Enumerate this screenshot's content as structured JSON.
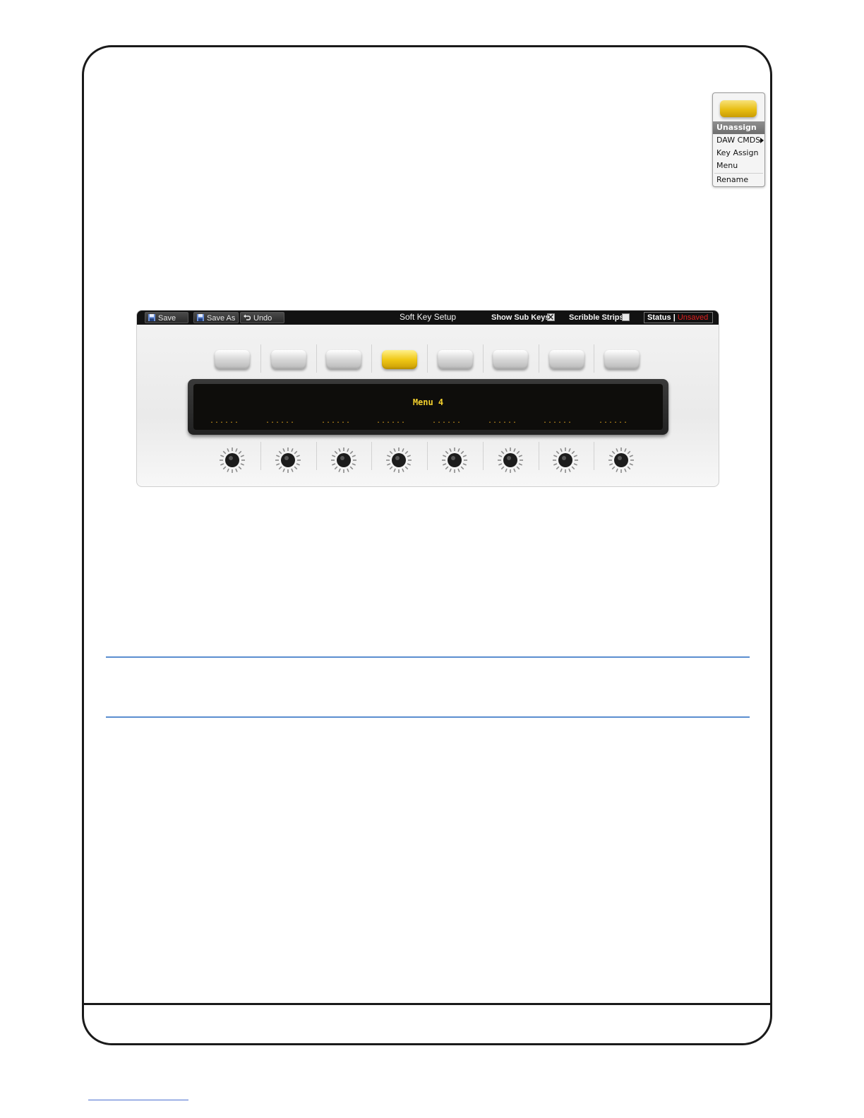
{
  "context_menu": {
    "items": [
      "Unassign",
      "DAW CMDS",
      "Key Assign",
      "Menu",
      "Rename"
    ],
    "selected_item": "Unassign",
    "key_color": "#e8be13"
  },
  "toolbar": {
    "save_label": "Save",
    "save_as_label": "Save As",
    "undo_label": "Undo",
    "title": "Soft Key Setup",
    "show_sub_keys_label": "Show Sub Keys",
    "show_sub_keys_checked": true,
    "scribble_strips_label": "Scribble Strips",
    "scribble_strips_checked": false,
    "status_label": "Status",
    "status_separator": "|",
    "status_value": "Unsaved",
    "status_value_color": "#e02020"
  },
  "soft_keys": {
    "count": 8,
    "active_index": 3,
    "active_color": "#f0c816"
  },
  "display": {
    "title": "Menu 4",
    "slot_values": [
      "......",
      "......",
      "......",
      "......",
      "......",
      "......",
      "......",
      "......"
    ]
  },
  "knobs": {
    "count": 8
  }
}
